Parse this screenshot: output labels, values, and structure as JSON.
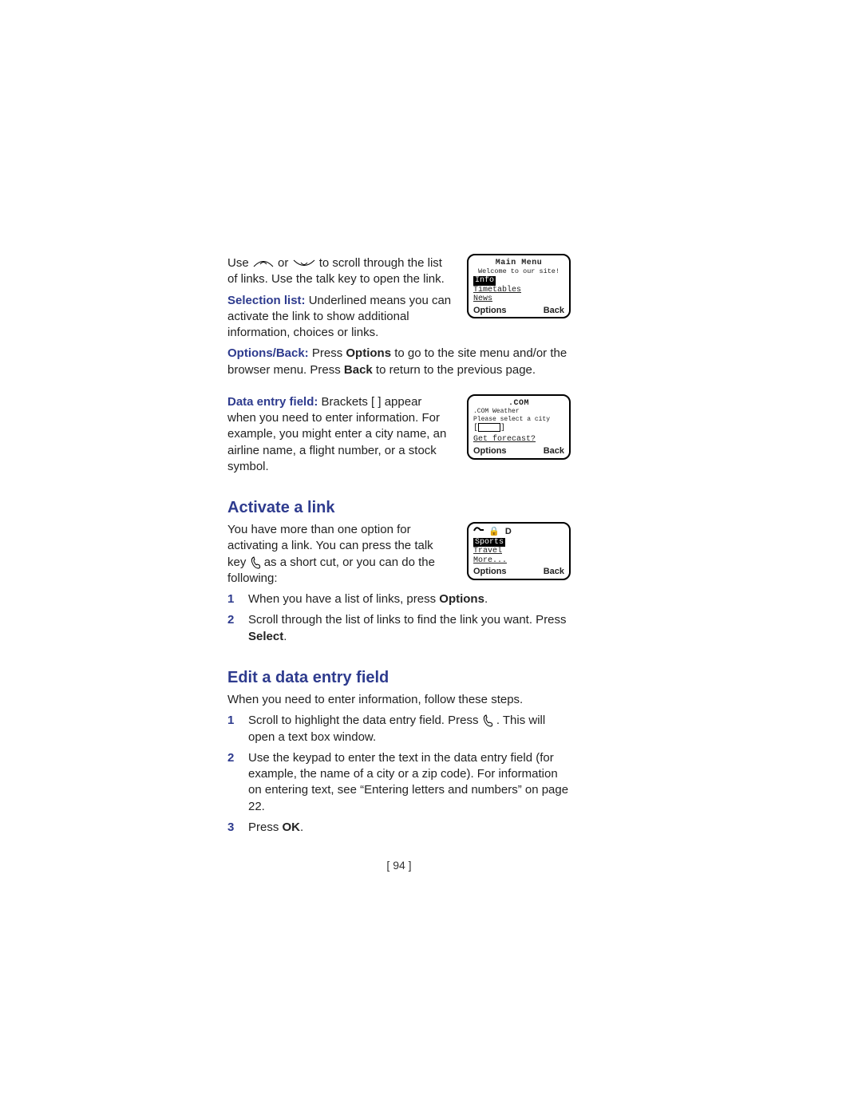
{
  "intro": {
    "use_scroll": "Use ",
    "or_word": " or ",
    "scroll_tail": " to scroll through the list of links. Use the talk key to open the link."
  },
  "selection_list": {
    "term": "Selection list:",
    "text": " Underlined means you can activate the link to show additional information, choices or links."
  },
  "options_back": {
    "term": "Options/Back:",
    "text_a": " Press ",
    "opt": "Options",
    "text_b": " to go to the site menu and/or the browser menu. Press ",
    "back": "Back",
    "text_c": " to return to the previous page."
  },
  "data_entry_field": {
    "term": "Data entry field:",
    "text": " Brackets [ ] appear when you need to enter information. For example, you might enter a city name, an airline name, a flight number, or a stock symbol."
  },
  "activate": {
    "heading": "Activate a link",
    "lead_a": "You have more than one option for activating a link. You can press the talk key ",
    "lead_b": " as a short cut, or you can do the following:",
    "steps": [
      {
        "n": "1",
        "a": "When you have a list of links, press ",
        "b": "Options",
        "c": "."
      },
      {
        "n": "2",
        "a": "Scroll through the list of links to find the link you want. Press ",
        "b": "Select",
        "c": "."
      }
    ]
  },
  "edit": {
    "heading": "Edit a data entry field",
    "lead": "When you need to enter information, follow these steps.",
    "steps": [
      {
        "n": "1",
        "a": "Scroll to highlight the data entry field. Press ",
        "c": ". This will open a text box window."
      },
      {
        "n": "2",
        "a": "Use the keypad to enter the text in the data entry field (for example, the name of a city or a zip code). For information on entering text, see “Entering letters and numbers” on page 22."
      },
      {
        "n": "3",
        "a": "Press ",
        "b": "OK",
        "c": "."
      }
    ]
  },
  "screens": {
    "main": {
      "title": "Main Menu",
      "subtitle": "Welcome to our site!",
      "items": [
        "Info",
        "Timetables",
        "News"
      ],
      "soft_left": "Options",
      "soft_right": "Back"
    },
    "weather": {
      "title": ".COM",
      "subtitle": ".COM Weather",
      "prompt": "Please select a city",
      "link": "Get forecast?",
      "soft_left": "Options",
      "soft_right": "Back"
    },
    "links": {
      "items": [
        "Sports",
        "Travel",
        "More..."
      ],
      "soft_left": "Options",
      "soft_right": "Back"
    }
  },
  "page_num": "[ 94 ]"
}
